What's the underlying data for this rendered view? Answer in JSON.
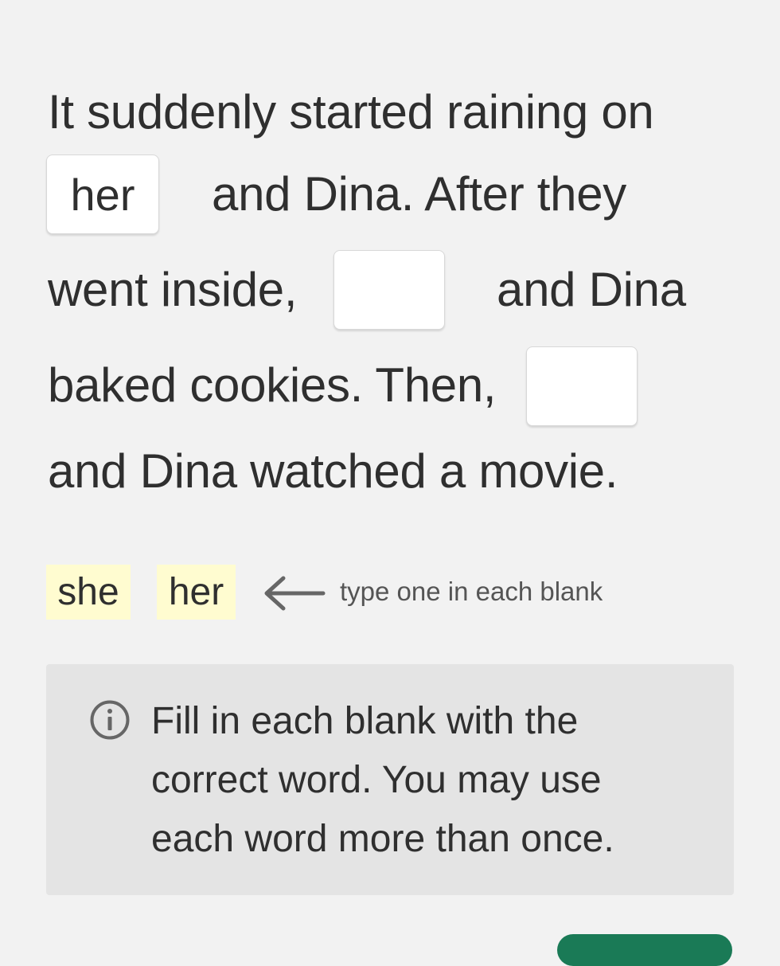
{
  "passage": {
    "line1": "It suddenly started raining on",
    "line2_after_blank": "and Dina. After they",
    "line3_before_blank": "went inside,",
    "line3_after_blank": "and Dina",
    "line4_before_blank": "baked cookies. Then,",
    "line5": "and Dina watched a movie.",
    "blank1_value": "her",
    "blank2_value": "",
    "blank3_value": ""
  },
  "word_bank": {
    "words": [
      "she",
      "her"
    ],
    "hint": "type one in each blank",
    "chip_color": "#fffcd0"
  },
  "instructions": {
    "text": "Fill in each blank with the correct word. You may use each word more than once."
  },
  "icons": {
    "arrow": "arrow-left-icon",
    "info": "info-icon"
  },
  "colors": {
    "background": "#f2f2f2",
    "info_box": "#e4e4e4",
    "button": "#1a7a56"
  }
}
